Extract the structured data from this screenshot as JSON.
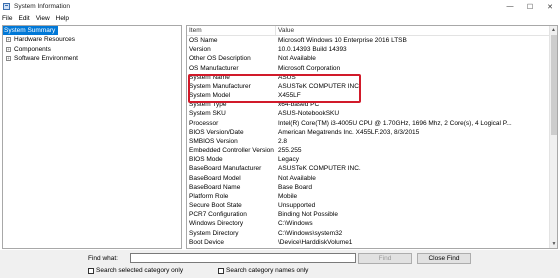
{
  "window": {
    "title": "System Information",
    "controls": [
      "—",
      "☐",
      "✕"
    ]
  },
  "menu": [
    "File",
    "Edit",
    "View",
    "Help"
  ],
  "tree": {
    "root": "System Summary",
    "children": [
      "Hardware Resources",
      "Components",
      "Software Environment"
    ]
  },
  "list": {
    "headers": {
      "item": "Item",
      "value": "Value"
    },
    "rows": [
      {
        "item": "OS Name",
        "value": "Microsoft Windows 10 Enterprise 2016 LTSB"
      },
      {
        "item": "Version",
        "value": "10.0.14393 Build 14393"
      },
      {
        "item": "Other OS Description",
        "value": "Not Available"
      },
      {
        "item": "OS Manufacturer",
        "value": "Microsoft Corporation"
      },
      {
        "item": "System Name",
        "value": "ASUS"
      },
      {
        "item": "System Manufacturer",
        "value": "ASUSTeK COMPUTER INC."
      },
      {
        "item": "System Model",
        "value": "X455LF"
      },
      {
        "item": "System Type",
        "value": "x64-based PC"
      },
      {
        "item": "System SKU",
        "value": "ASUS-NotebookSKU"
      },
      {
        "item": "Processor",
        "value": "Intel(R) Core(TM) i3-4005U CPU @ 1.70GHz, 1696 Mhz, 2 Core(s), 4 Logical P..."
      },
      {
        "item": "BIOS Version/Date",
        "value": "American Megatrends Inc. X455LF.203, 8/3/2015"
      },
      {
        "item": "SMBIOS Version",
        "value": "2.8"
      },
      {
        "item": "Embedded Controller Version",
        "value": "255.255"
      },
      {
        "item": "BIOS Mode",
        "value": "Legacy"
      },
      {
        "item": "BaseBoard Manufacturer",
        "value": "ASUSTeK COMPUTER INC."
      },
      {
        "item": "BaseBoard Model",
        "value": "Not Available"
      },
      {
        "item": "BaseBoard Name",
        "value": "Base Board"
      },
      {
        "item": "Platform Role",
        "value": "Mobile"
      },
      {
        "item": "Secure Boot State",
        "value": "Unsupported"
      },
      {
        "item": "PCR7 Configuration",
        "value": "Binding Not Possible"
      },
      {
        "item": "Windows Directory",
        "value": "C:\\Windows"
      },
      {
        "item": "System Directory",
        "value": "C:\\Windows\\system32"
      },
      {
        "item": "Boot Device",
        "value": "\\Device\\HarddiskVolume1"
      }
    ]
  },
  "find": {
    "label": "Find what:",
    "value": "",
    "find_button": "Find",
    "close_button": "Close Find",
    "search_selected": "Search selected category only",
    "search_names": "Search category names only"
  },
  "colors": {
    "selection": "#0078d7",
    "highlight_box": "#d11a2a"
  }
}
